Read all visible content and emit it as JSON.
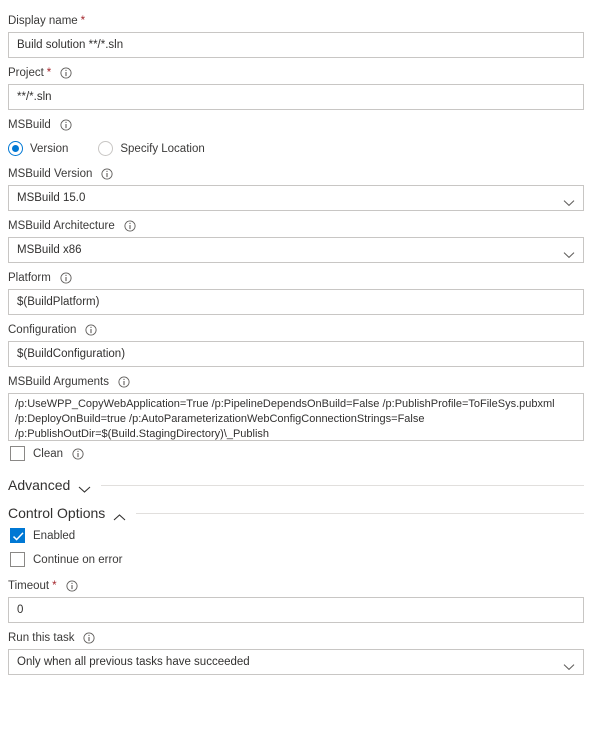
{
  "accent_color": "#0078d4",
  "required_color": "#a4262c",
  "border_color": "#c8c6c4",
  "fields": {
    "display_name": {
      "label": "Display name",
      "required": true,
      "has_info": false,
      "value": "Build solution **/*.sln"
    },
    "project": {
      "label": "Project",
      "required": true,
      "has_info": true,
      "value": "**/*.sln"
    },
    "msbuild": {
      "label": "MSBuild",
      "has_info": true,
      "options": [
        {
          "label": "Version",
          "selected": true
        },
        {
          "label": "Specify Location",
          "selected": false
        }
      ]
    },
    "msbuild_version": {
      "label": "MSBuild Version",
      "has_info": true,
      "value": "MSBuild 15.0",
      "options": [
        "MSBuild 15.0"
      ]
    },
    "msbuild_architecture": {
      "label": "MSBuild Architecture",
      "has_info": true,
      "value": "MSBuild x86",
      "options": [
        "MSBuild x86"
      ]
    },
    "platform": {
      "label": "Platform",
      "has_info": true,
      "value": "$(BuildPlatform)"
    },
    "configuration": {
      "label": "Configuration",
      "has_info": true,
      "value": "$(BuildConfiguration)"
    },
    "msbuild_arguments": {
      "label": "MSBuild Arguments",
      "has_info": true,
      "value": "/p:UseWPP_CopyWebApplication=True /p:PipelineDependsOnBuild=False /p:PublishProfile=ToFileSys.pubxml\n/p:DeployOnBuild=true /p:AutoParameterizationWebConfigConnectionStrings=False\n/p:PublishOutDir=$(Build.StagingDirectory)\\_Publish"
    },
    "clean": {
      "label": "Clean",
      "has_info": true,
      "checked": false
    },
    "enabled": {
      "label": "Enabled",
      "checked": true
    },
    "continue_on_error": {
      "label": "Continue on error",
      "checked": false
    },
    "timeout": {
      "label": "Timeout",
      "required": true,
      "has_info": true,
      "value": "0"
    },
    "run_this_task": {
      "label": "Run this task",
      "has_info": true,
      "value": "Only when all previous tasks have succeeded",
      "options": [
        "Only when all previous tasks have succeeded"
      ]
    }
  },
  "sections": {
    "advanced": {
      "title": "Advanced",
      "expanded": false,
      "chevron": "chevron-down-icon"
    },
    "control_options": {
      "title": "Control Options",
      "expanded": true,
      "chevron": "chevron-up-icon"
    }
  }
}
